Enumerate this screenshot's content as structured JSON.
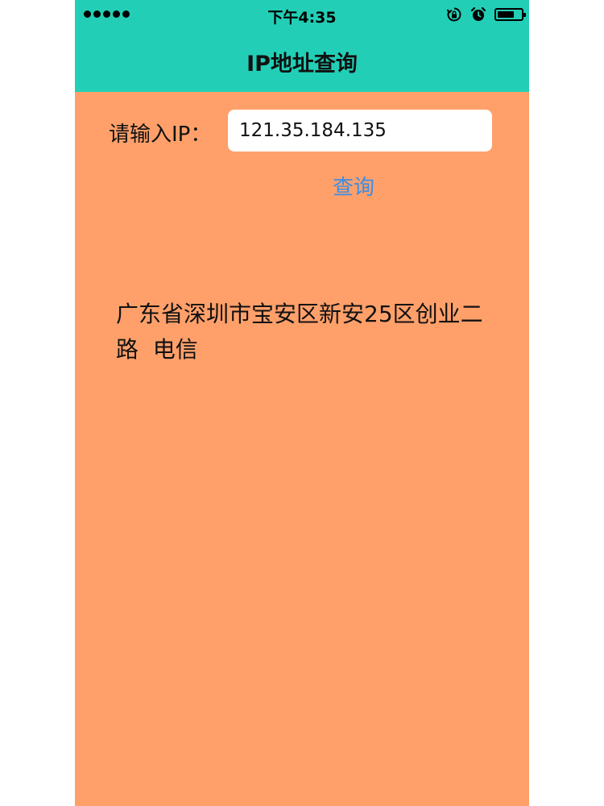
{
  "status_bar": {
    "time": "下午4:35",
    "icons": [
      "signal-dots-icon",
      "rotation-lock-icon",
      "alarm-icon",
      "battery-icon"
    ],
    "battery_level": 0.7
  },
  "header": {
    "title": "IP地址查询"
  },
  "form": {
    "ip_label": "请输入IP：",
    "ip_value": "121.35.184.135",
    "query_label": "查询"
  },
  "result": {
    "text": "广东省深圳市宝安区新安25区创业二路  电信"
  },
  "colors": {
    "header_bg": "#22CFB6",
    "content_bg": "#FFA06A",
    "link": "#3A8EE6"
  }
}
